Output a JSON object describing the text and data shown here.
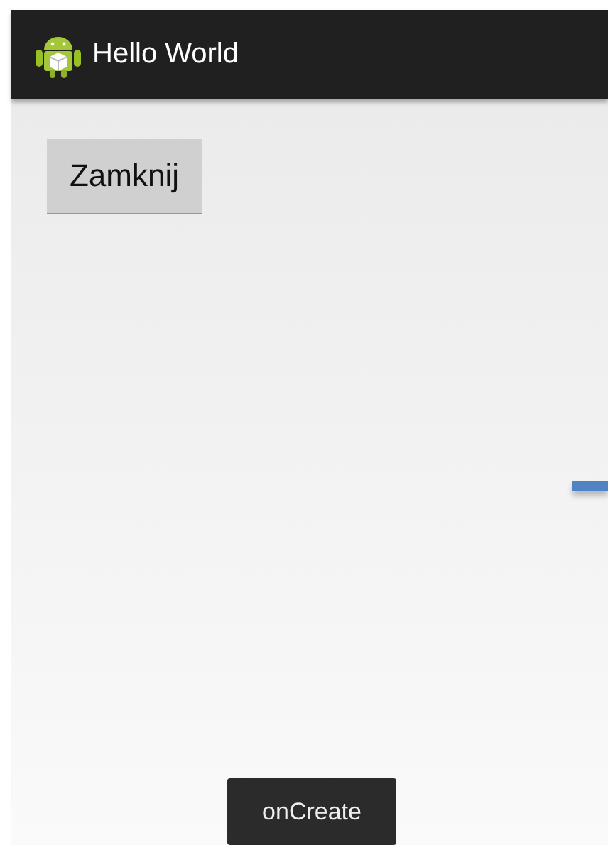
{
  "action_bar": {
    "title": "Hello World"
  },
  "buttons": [
    {
      "label": "Zamknij"
    }
  ],
  "toast": {
    "text": "onCreate"
  }
}
